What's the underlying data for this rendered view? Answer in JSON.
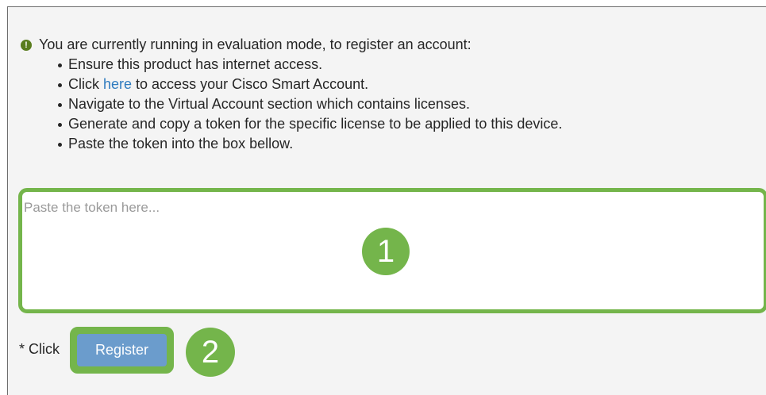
{
  "notice": {
    "icon": "exclamation-circle-icon",
    "intro": "You are currently running in evaluation mode, to register an account:",
    "steps": [
      {
        "text": "Ensure this product has internet access."
      },
      {
        "before": "Click ",
        "link": "here",
        "after": " to access your Cisco Smart Account."
      },
      {
        "text": "Navigate to the Virtual Account section which contains licenses."
      },
      {
        "text": "Generate and copy a token for the specific license to be applied to this device."
      },
      {
        "text": "Paste the token into the box bellow."
      }
    ]
  },
  "token_input": {
    "placeholder": "Paste the token here...",
    "value": ""
  },
  "annotations": {
    "marker_1": "1",
    "marker_2": "2",
    "highlight_color": "#74b54b"
  },
  "register": {
    "prefix": "* Click",
    "button_label": "Register",
    "button_color": "#6b9ccc"
  },
  "colors": {
    "link": "#2f7bbf",
    "panel_background": "#f4f4f4"
  }
}
